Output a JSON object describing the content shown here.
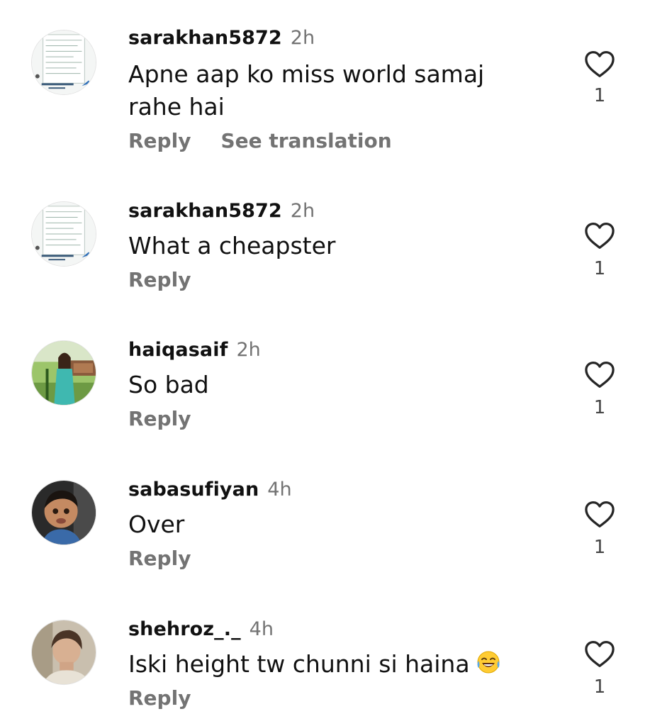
{
  "comments": [
    {
      "username": "sarakhan5872",
      "time": "2h",
      "text_lines": [
        "Apne aap ko miss world samaj",
        "rahe hai"
      ],
      "actions": [
        "Reply",
        "See translation"
      ],
      "likes": "1",
      "avatar_icon": "document-screenshot-avatar"
    },
    {
      "username": "sarakhan5872",
      "time": "2h",
      "text_lines": [
        "What a cheapster"
      ],
      "actions": [
        "Reply"
      ],
      "likes": "1",
      "avatar_icon": "document-screenshot-avatar"
    },
    {
      "username": "haiqasaif",
      "time": "2h",
      "text_lines": [
        "So bad"
      ],
      "actions": [
        "Reply"
      ],
      "likes": "1",
      "avatar_icon": "woman-outdoor-photo-avatar"
    },
    {
      "username": "sabasufiyan",
      "time": "4h",
      "text_lines": [
        "Over"
      ],
      "actions": [
        "Reply"
      ],
      "likes": "1",
      "avatar_icon": "child-photo-avatar"
    },
    {
      "username": "shehroz_._",
      "time": "4h",
      "text_lines": [
        "Iski height tw chunni si haina"
      ],
      "emoji": "😂",
      "actions": [
        "Reply"
      ],
      "likes": "1",
      "avatar_icon": "man-portrait-avatar"
    }
  ],
  "colors": {
    "text": "#111111",
    "muted": "#737373",
    "like_count": "#444444",
    "heart_stroke": "#262626",
    "background": "#ffffff"
  }
}
